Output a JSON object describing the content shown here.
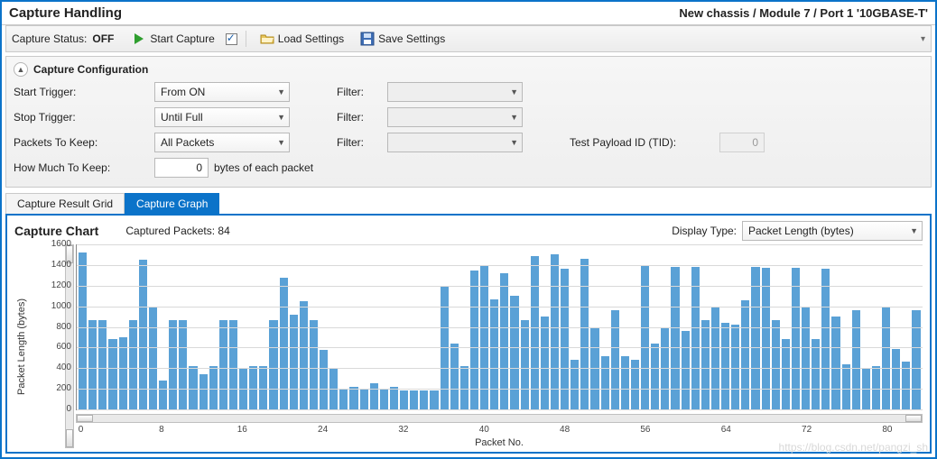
{
  "header": {
    "title": "Capture Handling",
    "breadcrumb": "New chassis / Module 7 / Port 1 '10GBASE-T'"
  },
  "toolbar": {
    "status_label": "Capture Status:",
    "status_value": "OFF",
    "start_capture": "Start Capture",
    "load_settings": "Load Settings",
    "save_settings": "Save Settings"
  },
  "config": {
    "panel_title": "Capture Configuration",
    "start_trigger_label": "Start Trigger:",
    "start_trigger_value": "From ON",
    "stop_trigger_label": "Stop Trigger:",
    "stop_trigger_value": "Until Full",
    "packets_to_keep_label": "Packets To Keep:",
    "packets_to_keep_value": "All Packets",
    "how_much_label": "How Much To Keep:",
    "how_much_value": "0",
    "how_much_suffix": "bytes of each packet",
    "filter_label": "Filter:",
    "tid_label": "Test Payload ID (TID):",
    "tid_value": "0"
  },
  "tabs": {
    "result_grid": "Capture Result Grid",
    "graph": "Capture Graph"
  },
  "chart": {
    "title": "Capture Chart",
    "captured_label": "Captured Packets:",
    "captured_value": "84",
    "display_type_label": "Display Type:",
    "display_type_value": "Packet Length (bytes)",
    "ylabel": "Packet Length (bytes)",
    "xlabel": "Packet No."
  },
  "chart_data": {
    "type": "bar",
    "xlabel": "Packet No.",
    "ylabel": "Packet Length (bytes)",
    "ylim": [
      0,
      1600
    ],
    "yticks": [
      0,
      200,
      400,
      600,
      800,
      1000,
      1200,
      1400,
      1600
    ],
    "xticks": [
      0,
      8,
      16,
      24,
      32,
      40,
      48,
      56,
      64,
      72,
      80
    ],
    "x": [
      0,
      1,
      2,
      3,
      4,
      5,
      6,
      7,
      8,
      9,
      10,
      11,
      12,
      13,
      14,
      15,
      16,
      17,
      18,
      19,
      20,
      21,
      22,
      23,
      24,
      25,
      26,
      27,
      28,
      29,
      30,
      31,
      32,
      33,
      34,
      35,
      36,
      37,
      38,
      39,
      40,
      41,
      42,
      43,
      44,
      45,
      46,
      47,
      48,
      49,
      50,
      51,
      52,
      53,
      54,
      55,
      56,
      57,
      58,
      59,
      60,
      61,
      62,
      63,
      64,
      65,
      66,
      67,
      68,
      69,
      70,
      71,
      72,
      73,
      74,
      75,
      76,
      77,
      78,
      79,
      80,
      81,
      82,
      83
    ],
    "values": [
      1520,
      870,
      870,
      680,
      700,
      870,
      1450,
      1000,
      280,
      870,
      870,
      420,
      340,
      420,
      870,
      870,
      400,
      420,
      420,
      870,
      1280,
      920,
      1050,
      870,
      580,
      400,
      200,
      220,
      200,
      250,
      200,
      220,
      180,
      180,
      180,
      180,
      1200,
      640,
      420,
      1350,
      1400,
      1070,
      1320,
      1100,
      870,
      1490,
      900,
      1500,
      1360,
      480,
      1460,
      800,
      520,
      960,
      520,
      480,
      1400,
      640,
      800,
      1380,
      760,
      1380,
      870,
      1000,
      840,
      820,
      1060,
      1380,
      1370,
      870,
      680,
      1370,
      1000,
      680,
      1360,
      900,
      440,
      960,
      400,
      420,
      1000,
      590,
      460,
      960
    ]
  },
  "watermark": "https://blog.csdn.net/pangzi_sh"
}
